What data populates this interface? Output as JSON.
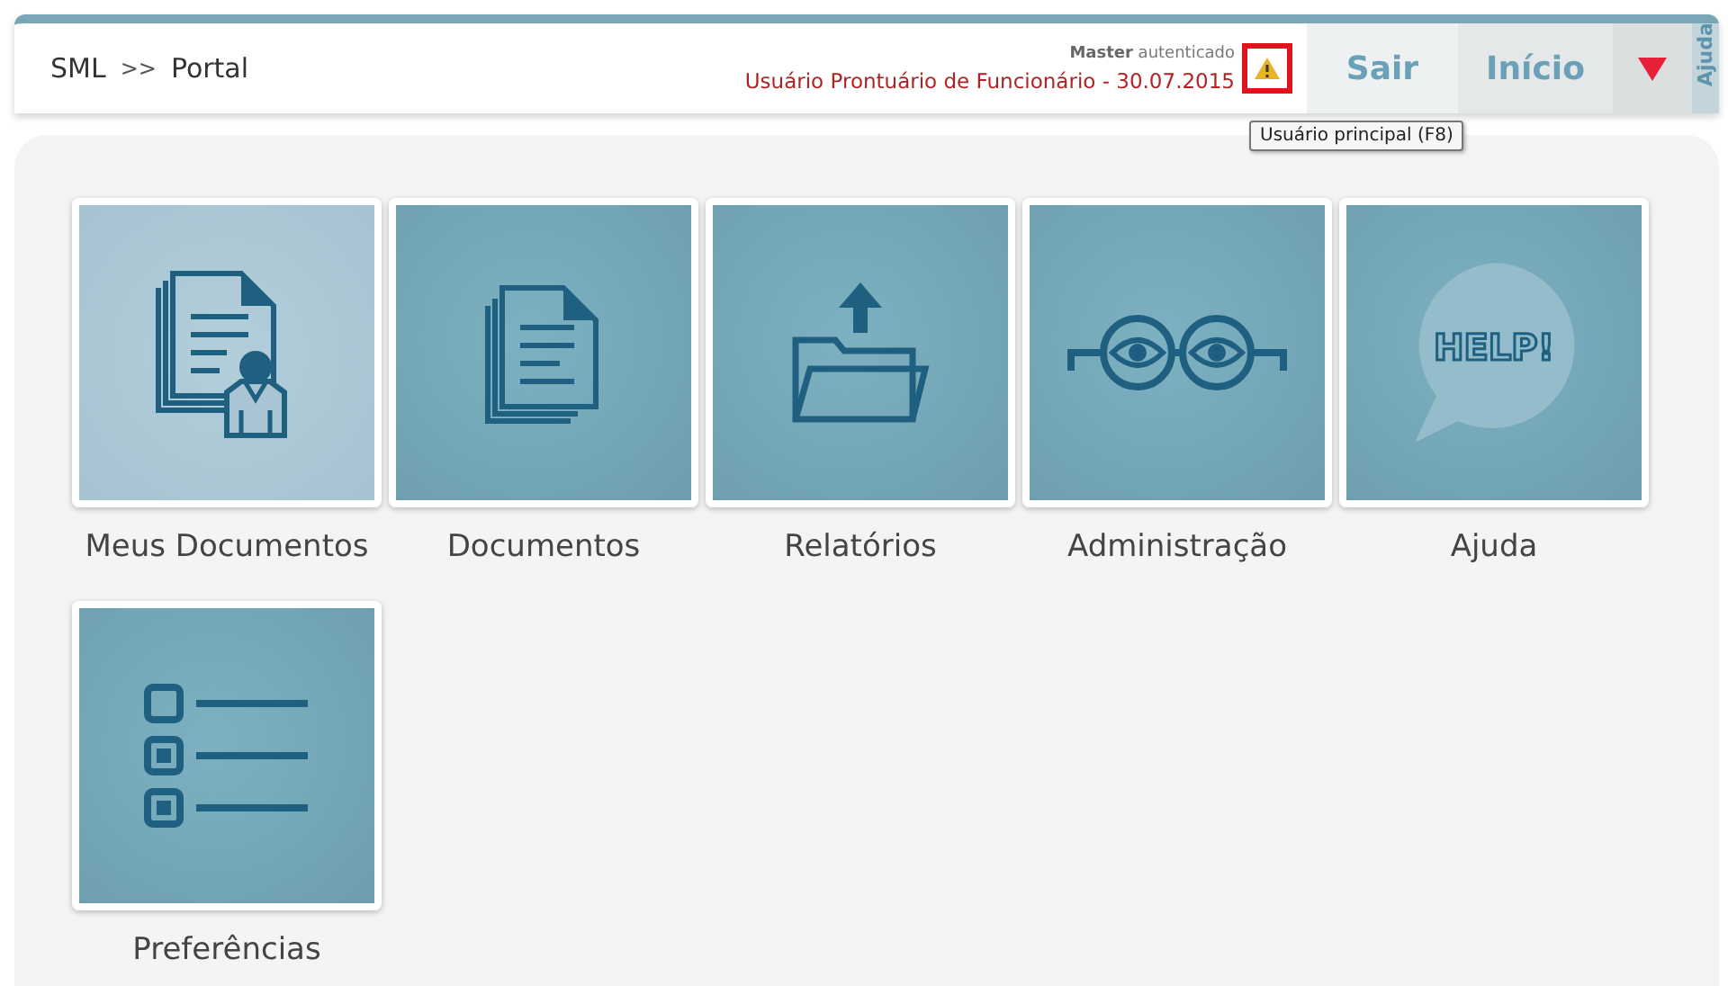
{
  "header": {
    "breadcrumb": [
      {
        "label": "SML"
      },
      {
        "label": ">>"
      },
      {
        "label": "Portal"
      }
    ],
    "session": {
      "role": "Master",
      "status": "autenticado",
      "user": "Usuário Prontuário de Funcionário - 30.07.2015",
      "warning_highlighted": true
    },
    "tooltip": "Usuário principal (F8)",
    "buttons": [
      {
        "label": "Sair"
      },
      {
        "label": "Início"
      }
    ],
    "side_tab": "Ajuda"
  },
  "tiles": [
    {
      "label": "Meus Documentos",
      "kind": "profile",
      "selected": true
    },
    {
      "label": "Documentos",
      "kind": "documents",
      "selected": false
    },
    {
      "label": "Relatórios",
      "kind": "upload",
      "selected": false
    },
    {
      "label": "Administração",
      "kind": "glasses",
      "selected": false
    },
    {
      "label": "Ajuda",
      "kind": "help",
      "icon_text": "HELP!",
      "selected": false
    },
    {
      "label": "Preferências",
      "kind": "checklist",
      "selected": false
    }
  ]
}
